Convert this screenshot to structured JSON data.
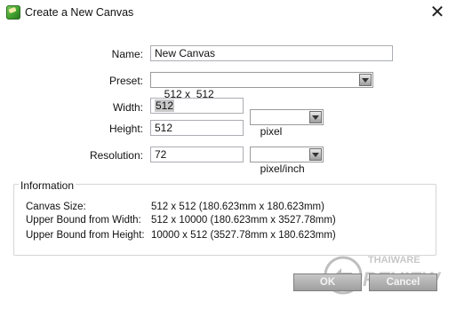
{
  "window": {
    "title": "Create a New Canvas",
    "close_glyph": "✕"
  },
  "form": {
    "name_label": "Name:",
    "name_value": "New Canvas",
    "preset_label": "Preset:",
    "preset_value": "512 x  512",
    "width_label": "Width:",
    "width_value": "512",
    "height_label": "Height:",
    "height_value": "512",
    "unit_value": "pixel",
    "resolution_label": "Resolution:",
    "resolution_value": "72",
    "resolution_unit_value": "pixel/inch"
  },
  "information": {
    "title": "Information",
    "rows": [
      {
        "label": "Canvas Size:",
        "value": "512 x 512 (180.623mm x 180.623mm)"
      },
      {
        "label": "Upper Bound from Width:",
        "value": "512 x 10000 (180.623mm x 3527.78mm)"
      },
      {
        "label": "Upper Bound from Height:",
        "value": "10000 x 512 (3527.78mm x 180.623mm)"
      }
    ]
  },
  "buttons": {
    "ok_label": "OK",
    "cancel_label": "Cancel"
  },
  "watermark": {
    "line1": "THAIWARE",
    "line2": "REVIEW"
  }
}
